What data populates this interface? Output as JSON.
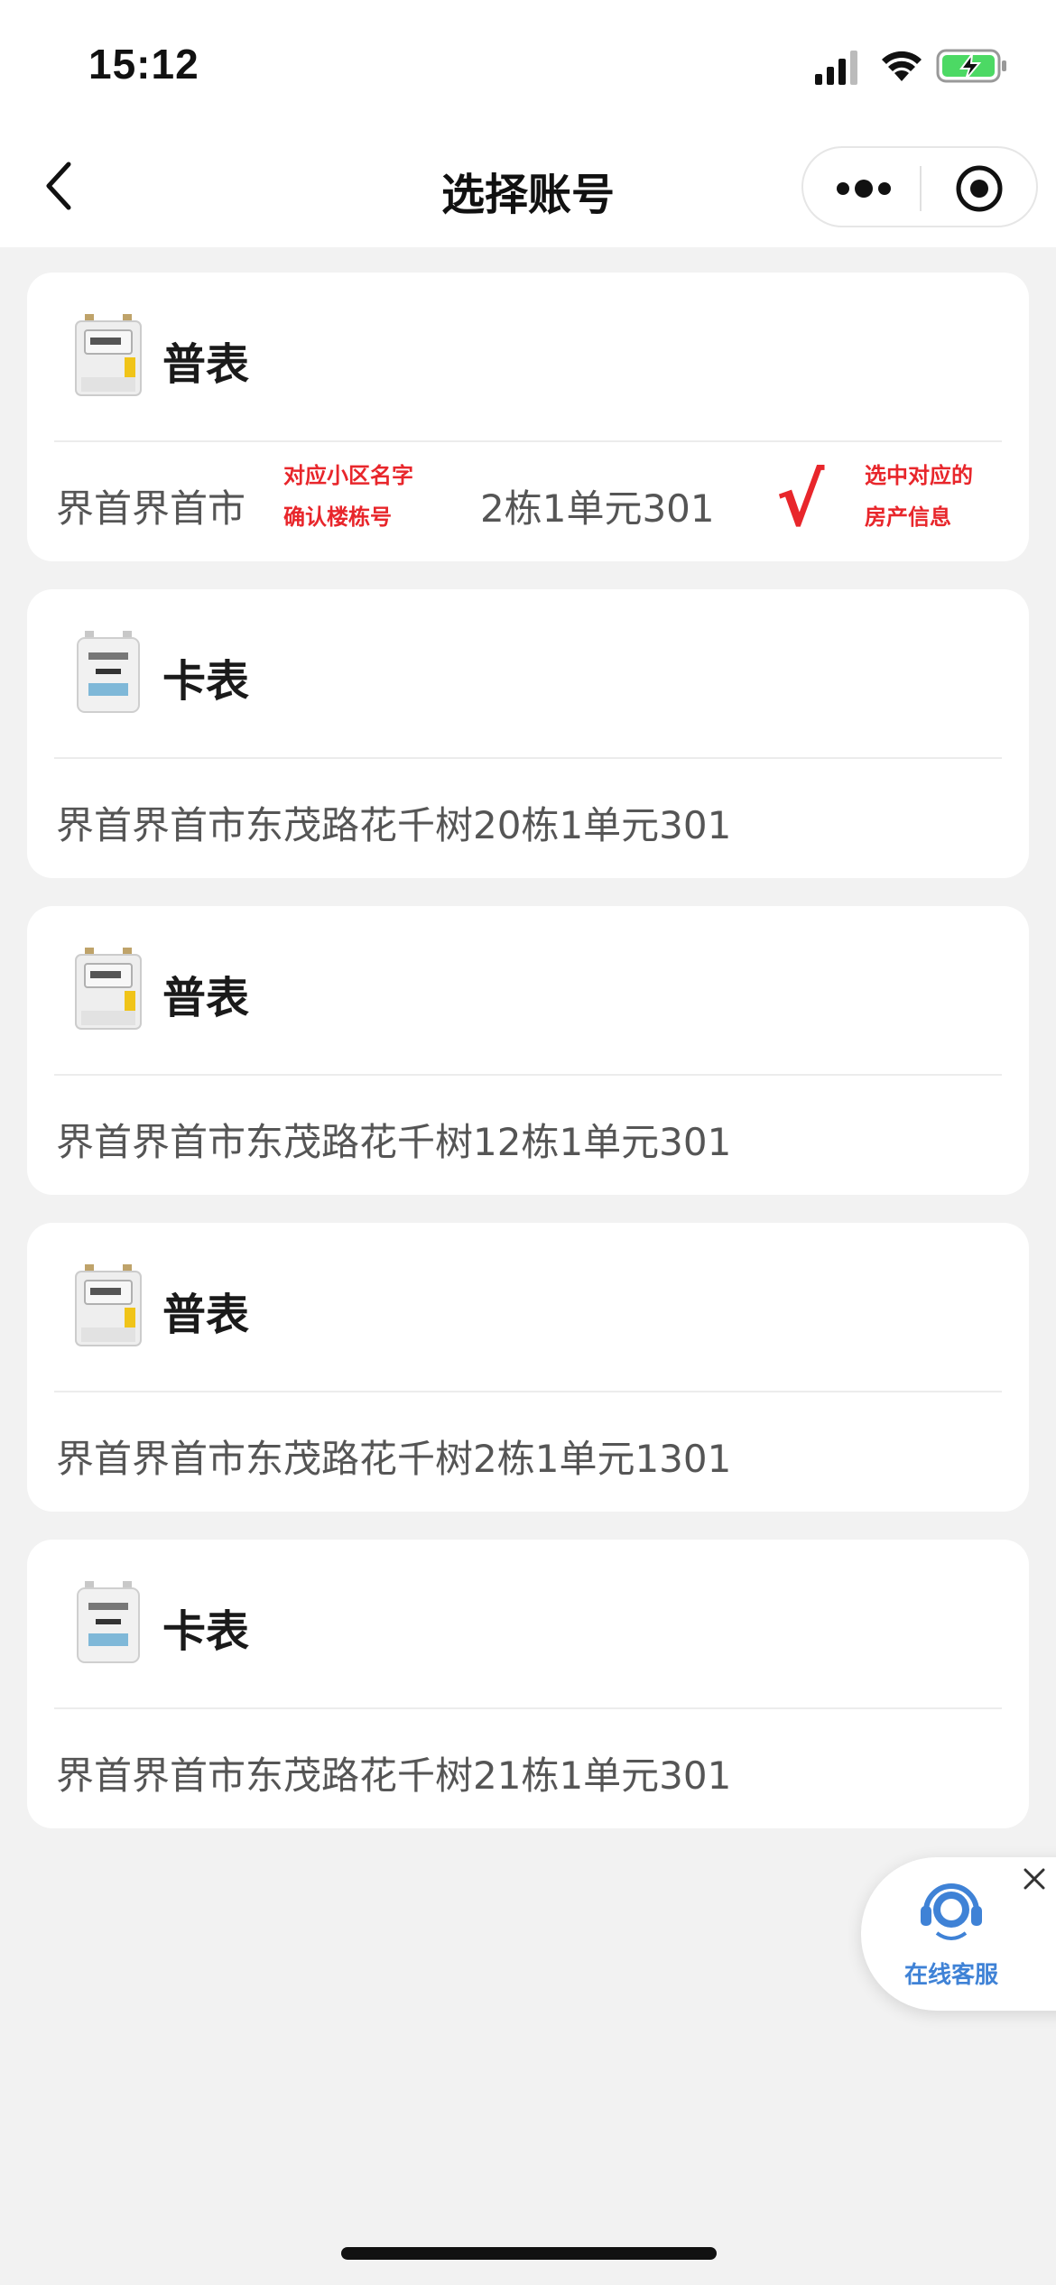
{
  "status_bar": {
    "time": "15:12"
  },
  "nav": {
    "title": "选择账号"
  },
  "accounts": [
    {
      "meter_type": "普表",
      "meter_icon": "standard-meter",
      "address": "界首界首市",
      "address_suffix": "2栋1单元301",
      "annotation_left": [
        "对应小区名字",
        "确认楼栋号"
      ],
      "check_mark": "√",
      "annotation_right": [
        "选中对应的",
        "房产信息"
      ]
    },
    {
      "meter_type": "卡表",
      "meter_icon": "card-meter",
      "address": "界首界首市东茂路花千树20栋1单元301"
    },
    {
      "meter_type": "普表",
      "meter_icon": "standard-meter",
      "address": "界首界首市东茂路花千树12栋1单元301"
    },
    {
      "meter_type": "普表",
      "meter_icon": "standard-meter",
      "address": "界首界首市东茂路花千树2栋1单元1301"
    },
    {
      "meter_type": "卡表",
      "meter_icon": "card-meter",
      "address": "界首界首市东茂路花千树21栋1单元301"
    }
  ],
  "support": {
    "label": "在线客服"
  },
  "colors": {
    "accent_red": "#e8262b",
    "support_blue": "#3f82d6"
  }
}
